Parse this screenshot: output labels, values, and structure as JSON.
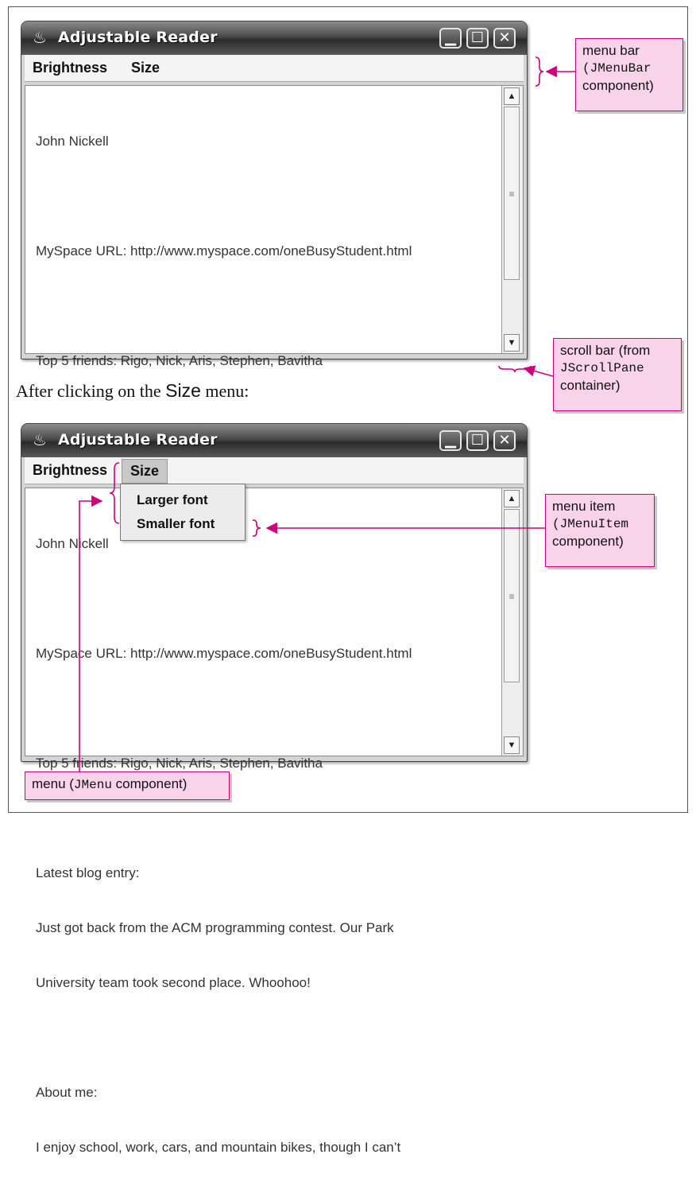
{
  "window": {
    "title": "Adjustable Reader",
    "menus": [
      "Brightness",
      "Size"
    ],
    "controls": [
      "minimize",
      "maximize",
      "close"
    ],
    "content_lines": [
      "John Nickell",
      "",
      "MySpace URL: http://www.myspace.com/oneBusyStudent.html",
      "",
      "Top 5 friends: Rigo, Nick, Aris, Stephen, Bavitha",
      "",
      "Latest blog entry:",
      "Just got back from the ACM programming contest. Our Park",
      "University team took second place. Whoohoo!",
      "",
      "About me:",
      "I enjoy school, work, cars, and mountain bikes, though I can’t"
    ]
  },
  "caption": {
    "before": "After clicking on the ",
    "menu_word": "Size",
    "after": " menu:"
  },
  "size_menu_items": [
    "Larger font",
    "Smaller font"
  ],
  "callouts": {
    "menubar": {
      "line1": "menu bar",
      "mono": "(JMenuBar",
      "line3": "component)"
    },
    "scrollbar": {
      "line1": "scroll bar (from",
      "mono": "JScrollPane",
      "line3": "container)"
    },
    "menuitem": {
      "line1": "menu item",
      "mono": "(JMenuItem",
      "line3": "component)"
    },
    "menu": {
      "pre": "menu (",
      "mono": "JMenu",
      "post": " component)"
    }
  },
  "colors": {
    "callout_fill": "#f9d3ea",
    "callout_line": "#d0007a"
  }
}
